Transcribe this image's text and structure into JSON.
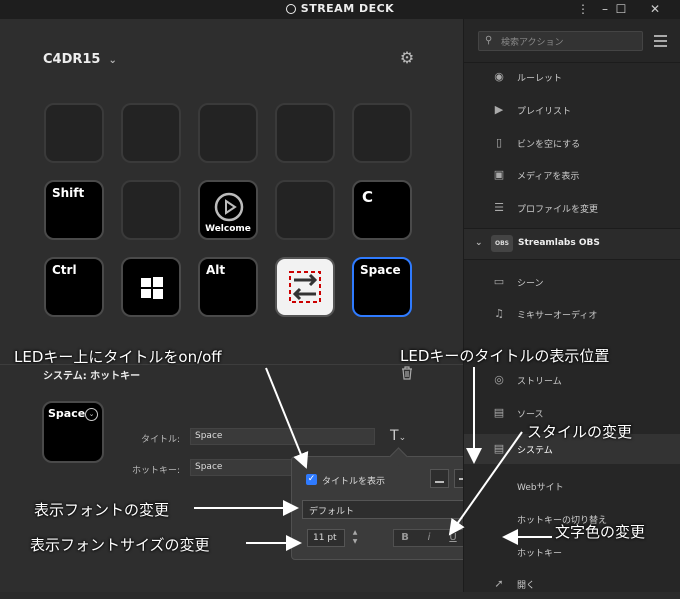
{
  "titlebar": {
    "app_title": "STREAM DECK",
    "icons": [
      "app-logo-icon",
      "more-icon",
      "minimize-icon",
      "maximize-icon",
      "close-icon"
    ]
  },
  "profile": {
    "name": "C4DR15"
  },
  "keys": {
    "shift": "Shift",
    "c": "C",
    "welcome": "Welcome",
    "ctrl": "Ctrl",
    "alt": "Alt",
    "space": "Space"
  },
  "properties": {
    "section_title": "システム: ホットキー",
    "key_title": "Space",
    "title_label": "タイトル:",
    "title_value": "Space",
    "hotkey_label": "ホットキー:",
    "hotkey_value": "Space"
  },
  "title_popover": {
    "show_title_label": "タイトルを表示",
    "show_title_checked": true,
    "alignment_selected": "top",
    "font": "デフォルト",
    "font_size": "11 pt",
    "style_bold": "B",
    "style_italic": "i",
    "style_underline": "U",
    "text_color": "#ffffff"
  },
  "action_list": {
    "search_placeholder": "検索アクション",
    "items_top": [
      "ルーレット",
      "プレイリスト",
      "ビンを空にする",
      "メディアを表示",
      "プロファイルを変更"
    ],
    "category": "Streamlabs OBS",
    "category_badge": "OBS",
    "items_obs": [
      "シーン",
      "ミキサーオーディオ",
      "ストリーム",
      "ソース",
      "システム",
      "Webサイト",
      "ホットキーの切り替え",
      "ホットキー",
      "開く"
    ]
  },
  "annotations": {
    "led_title_toggle": "LEDキー上にタイトルをon/off",
    "led_title_position": "LEDキーのタイトルの表示位置",
    "style_change": "スタイルの変更",
    "font_change": "表示フォントの変更",
    "font_size_change": "表示フォントサイズの変更",
    "text_color_change": "文字色の変更"
  }
}
